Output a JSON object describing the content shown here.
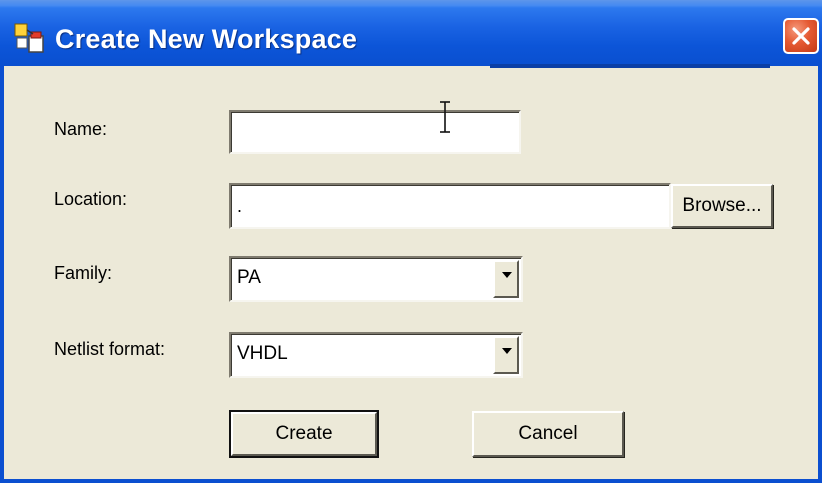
{
  "window": {
    "title": "Create New Workspace",
    "app_icon": "workspace-app-icon",
    "close_icon": "close-icon"
  },
  "form": {
    "name": {
      "label": "Name:",
      "value": ""
    },
    "location": {
      "label": "Location:",
      "value": ".",
      "browse_label": "Browse..."
    },
    "family": {
      "label": "Family:",
      "selected": "PA"
    },
    "netlist_format": {
      "label": "Netlist format:",
      "selected": "VHDL"
    }
  },
  "actions": {
    "create_label": "Create",
    "cancel_label": "Cancel"
  },
  "colors": {
    "titlebar": "#0c55d8",
    "dialog_bg": "#ece9d8",
    "close_button": "#e55a33"
  }
}
